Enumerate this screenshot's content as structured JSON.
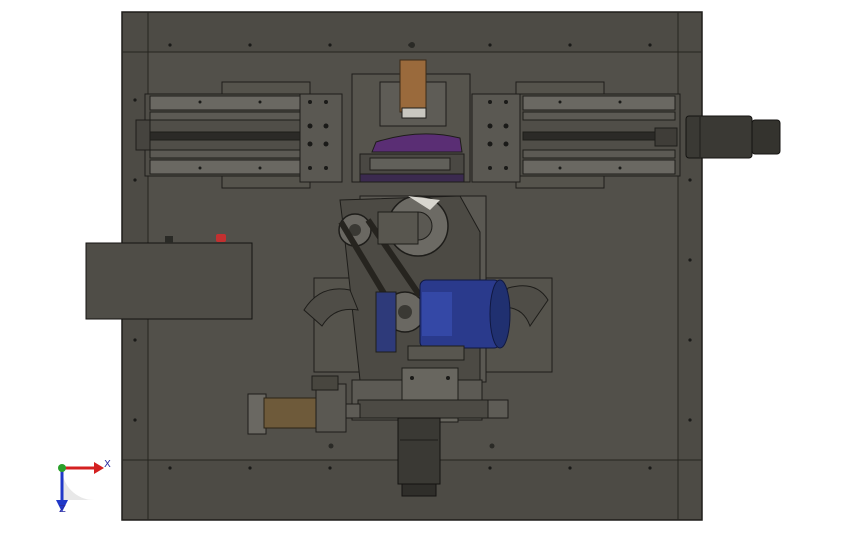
{
  "view": {
    "background": "#ffffff",
    "frame_color": "#4d4b45",
    "panel_color": "#54524b",
    "edge_color": "#1e1d1a",
    "motor_color": "#2a3a8c",
    "cylinder_color": "#6e5a3a",
    "clamp_color": "#5a2e74",
    "orange_color": "#a86a3a"
  },
  "triad": {
    "x_label": "X",
    "z_label": "Z",
    "x_color": "#d42020",
    "y_color": "#2aa02a",
    "z_color": "#2038c8"
  }
}
